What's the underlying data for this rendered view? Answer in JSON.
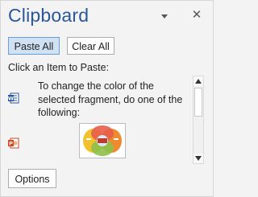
{
  "pane": {
    "title": "Clipboard",
    "menu_icon": "chevron-down-icon",
    "close_icon": "close-icon",
    "close_glyph": "✕"
  },
  "toolbar": {
    "paste_all_label": "Paste All",
    "clear_all_label": "Clear All"
  },
  "instruction": "Click an Item to Paste:",
  "items": [
    {
      "source": "word",
      "icon": "word-icon",
      "text": "To change the color of the selected fragment, do one of the following:"
    },
    {
      "source": "powerpoint",
      "icon": "powerpoint-icon",
      "text": ""
    }
  ],
  "footer": {
    "options_label": "Options"
  },
  "colors": {
    "title": "#2b579a",
    "accent_button_bg": "#cfe1f3",
    "accent_button_border": "#6d9fd6",
    "word_blue": "#2b579a",
    "powerpoint_red": "#d24726"
  }
}
